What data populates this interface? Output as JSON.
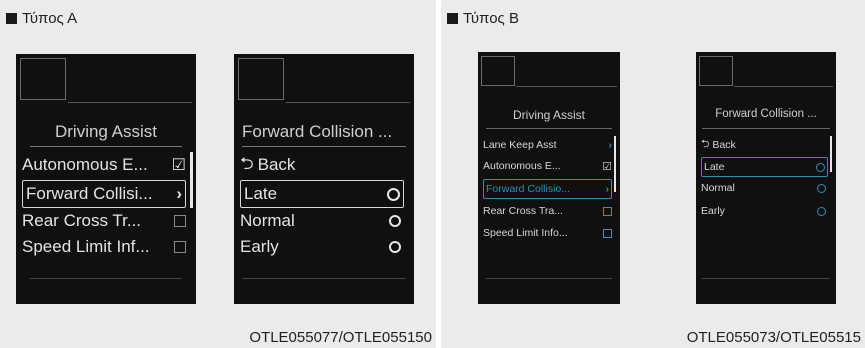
{
  "colors": {
    "panel_bg": "#ebebeb",
    "screen_bg": "#101010",
    "type_b_accent": "#2c8fb8"
  },
  "type_a": {
    "label": "Τύπος Α",
    "caption": "OTLE055077/OTLE055150",
    "left_screen": {
      "title": "Driving Assist",
      "items": [
        {
          "label": "Autonomous E...",
          "control": "checkbox-checked"
        },
        {
          "label": "Forward Collisi...",
          "control": "chevron",
          "selected": true
        },
        {
          "label": "Rear Cross Tr...",
          "control": "checkbox"
        },
        {
          "label": "Speed Limit Inf...",
          "control": "checkbox"
        }
      ]
    },
    "right_screen": {
      "title": "Forward Collision ...",
      "back_label": "Back",
      "options": [
        {
          "label": "Late",
          "selected": true
        },
        {
          "label": "Normal",
          "selected": false
        },
        {
          "label": "Early",
          "selected": false
        }
      ]
    }
  },
  "type_b": {
    "label": "Τύπος Β",
    "caption": "OTLE055073/OTLE05515",
    "left_screen": {
      "title": "Driving Assist",
      "items": [
        {
          "label": "Lane Keep Asst",
          "control": "chevron"
        },
        {
          "label": "Autonomous E...",
          "control": "checkbox-checked"
        },
        {
          "label": "Forward Collisio...",
          "control": "chevron",
          "selected": true
        },
        {
          "label": "Rear Cross Tra...",
          "control": "checkbox"
        },
        {
          "label": "Speed Limit Info...",
          "control": "checkbox"
        }
      ]
    },
    "right_screen": {
      "title": "Forward Collision ...",
      "back_label": "Back",
      "options": [
        {
          "label": "Late",
          "selected": true
        },
        {
          "label": "Normal",
          "selected": false
        },
        {
          "label": "Early",
          "selected": false
        }
      ]
    }
  }
}
